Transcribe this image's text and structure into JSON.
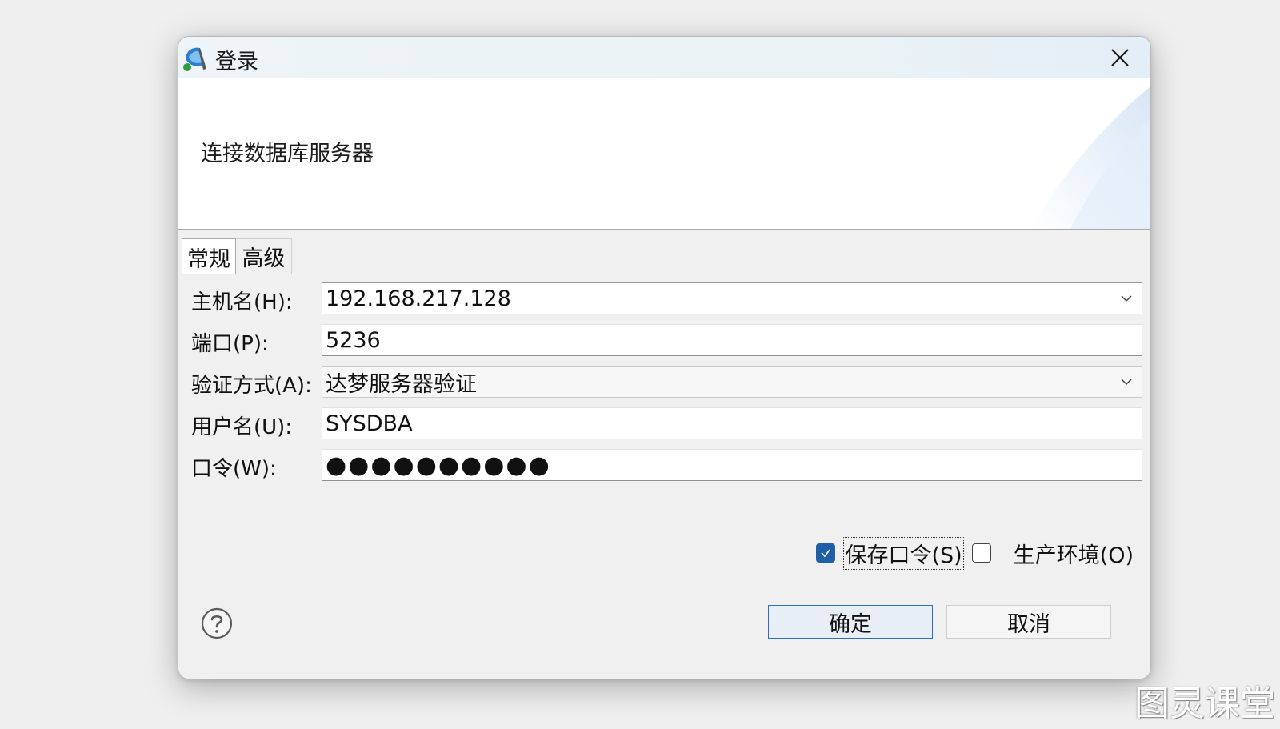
{
  "window": {
    "title": "登录",
    "banner_text": "连接数据库服务器"
  },
  "tabs": [
    {
      "label": "常规",
      "active": true
    },
    {
      "label": "高级",
      "active": false
    }
  ],
  "form": {
    "host_label": "主机名(H):",
    "host_value": "192.168.217.128",
    "port_label": "端口(P):",
    "port_value": "5236",
    "auth_label": "验证方式(A):",
    "auth_value": "达梦服务器验证",
    "user_label": "用户名(U):",
    "user_value": "SYSDBA",
    "password_label": "口令(W):",
    "password_value": "●●●●●●●●●●"
  },
  "options": {
    "save_password_label": "保存口令(S)",
    "save_password_checked": true,
    "production_label": "生产环境(O)",
    "production_checked": false
  },
  "buttons": {
    "ok_label": "确定",
    "cancel_label": "取消"
  },
  "watermark": "图灵课堂",
  "colors": {
    "accent": "#1f5fa8",
    "primary_button_border": "#2a6fc0"
  }
}
